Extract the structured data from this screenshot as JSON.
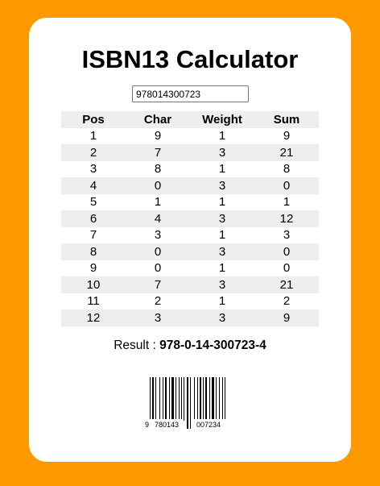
{
  "title": "ISBN13 Calculator",
  "input": {
    "value": "978014300723"
  },
  "table": {
    "headers": [
      "Pos",
      "Char",
      "Weight",
      "Sum"
    ],
    "rows": [
      [
        "1",
        "9",
        "1",
        "9"
      ],
      [
        "2",
        "7",
        "3",
        "21"
      ],
      [
        "3",
        "8",
        "1",
        "8"
      ],
      [
        "4",
        "0",
        "3",
        "0"
      ],
      [
        "5",
        "1",
        "1",
        "1"
      ],
      [
        "6",
        "4",
        "3",
        "12"
      ],
      [
        "7",
        "3",
        "1",
        "3"
      ],
      [
        "8",
        "0",
        "3",
        "0"
      ],
      [
        "9",
        "0",
        "1",
        "0"
      ],
      [
        "10",
        "7",
        "3",
        "21"
      ],
      [
        "11",
        "2",
        "1",
        "2"
      ],
      [
        "12",
        "3",
        "3",
        "9"
      ]
    ]
  },
  "result": {
    "label": "Result :",
    "value": "978-0-14-300723-4"
  },
  "barcode": {
    "lead_digit": "9",
    "left_group": "780143",
    "right_group": "007234"
  },
  "colors": {
    "background": "#ff9900",
    "card": "#ffffff",
    "row_stripe": "#eeeeee"
  }
}
